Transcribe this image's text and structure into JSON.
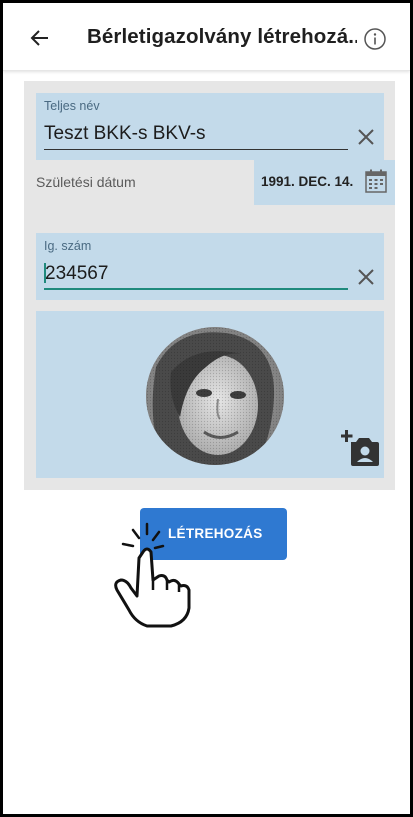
{
  "header": {
    "title": "Bérletigazolvány létrehozá...",
    "back_icon": "arrow-left-icon",
    "info_icon": "info-circle-icon"
  },
  "form": {
    "full_name": {
      "label": "Teljes név",
      "value": "Teszt BKK-s BKV-s"
    },
    "birth_date": {
      "label": "Születési dátum",
      "value": "1991. DEC. 14."
    },
    "id_number": {
      "label": "Ig. szám",
      "value": "234567"
    }
  },
  "actions": {
    "create_label": "LÉTREHOZÁS"
  },
  "colors": {
    "field_bg": "#c3daea",
    "panel_bg": "#e6e6e6",
    "accent": "#2f79d1",
    "focus_underline": "#1f8a7d"
  }
}
